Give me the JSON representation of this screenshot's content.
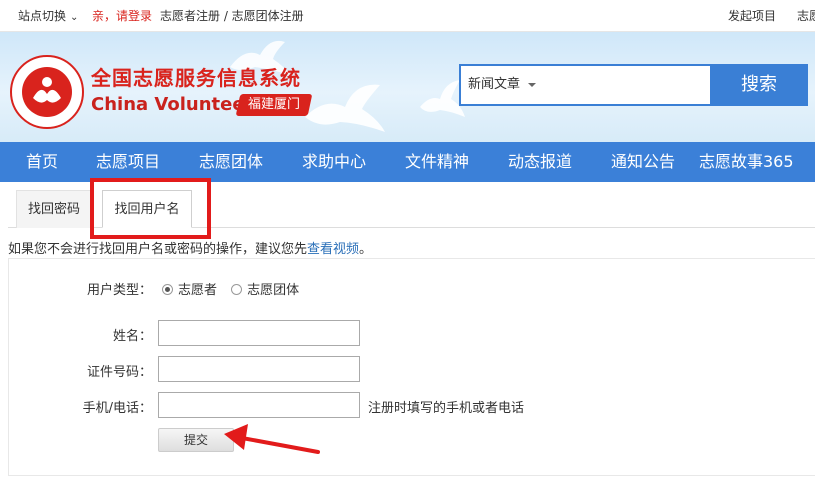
{
  "topbar": {
    "site_switch": "站点切换",
    "login": "亲，请登录",
    "register_links": "志愿者注册 / 志愿团体注册",
    "launch_project": "发起项目",
    "right_cut": "志愿"
  },
  "header": {
    "title_cn": "全国志愿服务信息系统",
    "title_en": "China Volunteer",
    "city": "福建厦门",
    "search": {
      "category": "新闻文章",
      "button": "搜索"
    }
  },
  "nav": [
    "首页",
    "志愿项目",
    "志愿团体",
    "求助中心",
    "文件精神",
    "动态报道",
    "通知公告",
    "志愿故事365"
  ],
  "tabs": [
    "找回密码",
    "找回用户名"
  ],
  "hint": {
    "text": "如果您不会进行找回用户名或密码的操作，建议您先",
    "link": "查看视频",
    "tail": "。"
  },
  "form": {
    "user_type_label": "用户类型：",
    "user_type_options": [
      "志愿者",
      "志愿团体"
    ],
    "name_label": "姓名：",
    "id_label": "证件号码：",
    "phone_label": "手机/电话：",
    "phone_note": "注册时填写的手机或者电话",
    "submit": "提交"
  },
  "colors": {
    "brand_red": "#d9231d",
    "nav_blue": "#3b80d8",
    "annotation_red": "#e21b1b"
  }
}
